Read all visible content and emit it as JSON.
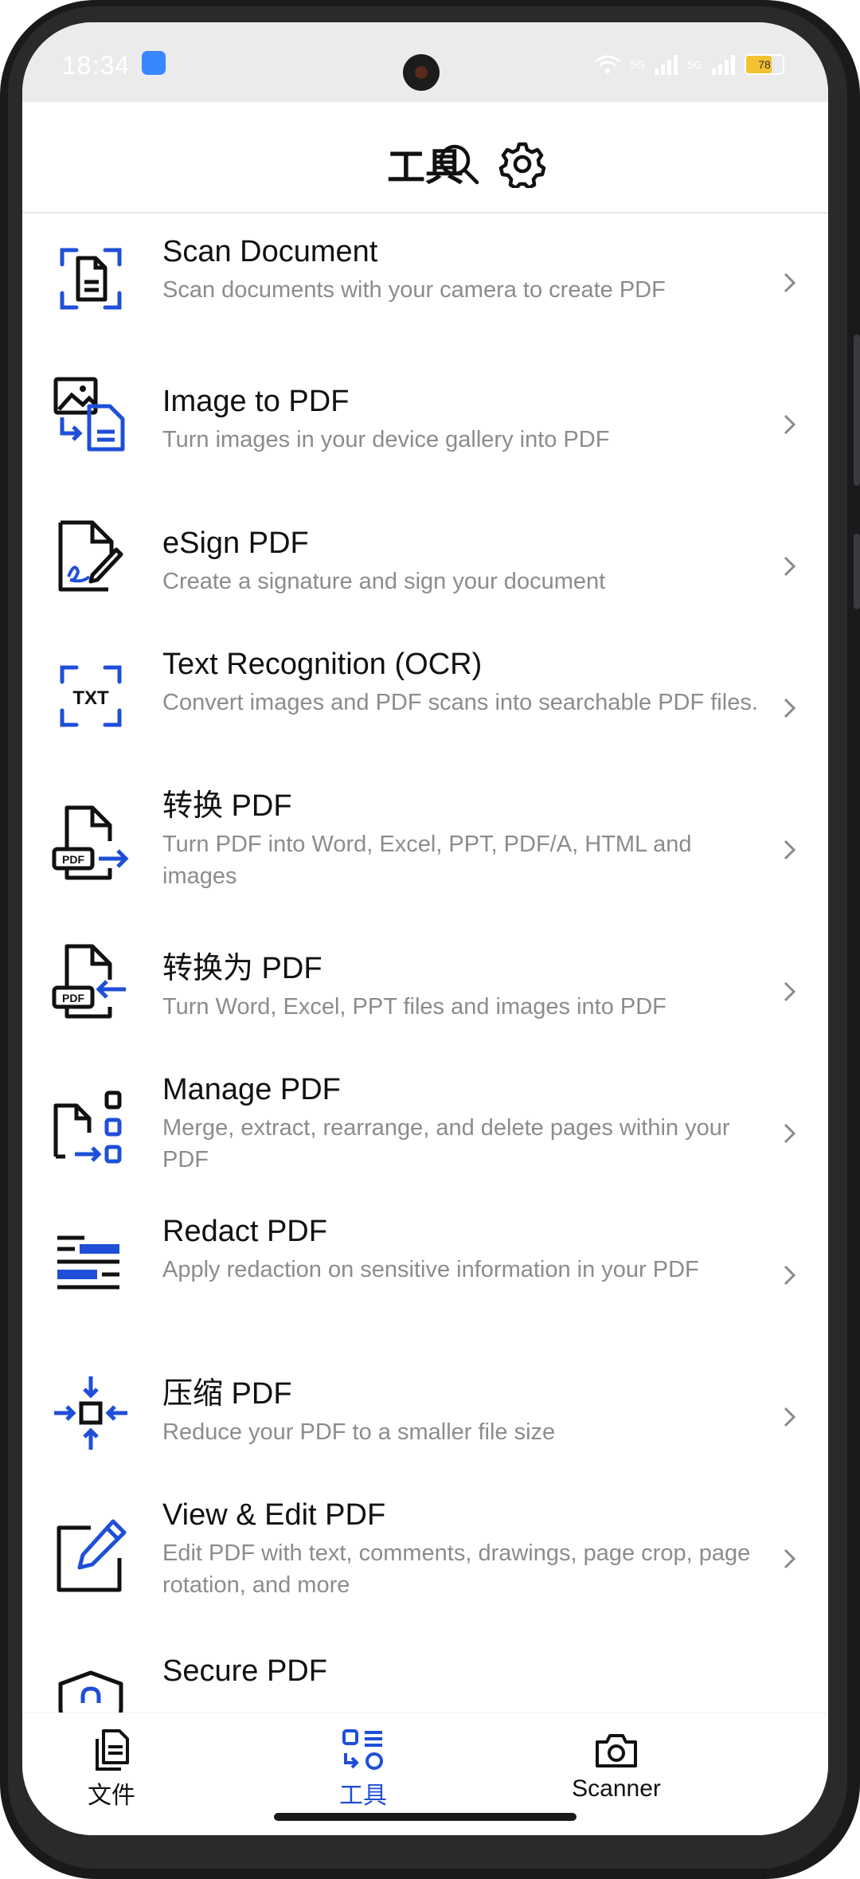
{
  "status_bar": {
    "time": "18:34",
    "network_1": "5G",
    "network_2": "5G",
    "battery": "78"
  },
  "header": {
    "title": "工具"
  },
  "tools": [
    {
      "name": "Scan Document",
      "desc": "Scan documents with your camera to create PDF"
    },
    {
      "name": "Image to PDF",
      "desc": "Turn images in your device gallery into PDF"
    },
    {
      "name": "eSign PDF",
      "desc": "Create a signature and sign your document"
    },
    {
      "name": "Text Recognition (OCR)",
      "desc": "Convert images and PDF scans into searchable PDF files.",
      "icon_text": "TXT"
    },
    {
      "name": "转换 PDF",
      "desc": "Turn PDF into Word, Excel, PPT, PDF/A, HTML and images",
      "icon_text": "PDF"
    },
    {
      "name": "转换为 PDF",
      "desc": "Turn Word, Excel, PPT files and images into PDF",
      "icon_text": "PDF"
    },
    {
      "name": "Manage PDF",
      "desc": "Merge, extract, rearrange, and delete pages within your PDF"
    },
    {
      "name": "Redact PDF",
      "desc": "Apply redaction on sensitive information in your PDF"
    },
    {
      "name": "压缩 PDF",
      "desc": "Reduce your PDF to a smaller file size"
    },
    {
      "name": "View & Edit PDF",
      "desc": "Edit PDF with text, comments, drawings, page crop, page rotation, and more"
    },
    {
      "name": "Secure PDF",
      "desc": ""
    }
  ],
  "nav": {
    "files": "文件",
    "tools": "工具",
    "scanner": "Scanner"
  },
  "colors": {
    "accent": "#1f4fd8",
    "text": "#111111",
    "secondary": "#8c8c8c"
  }
}
